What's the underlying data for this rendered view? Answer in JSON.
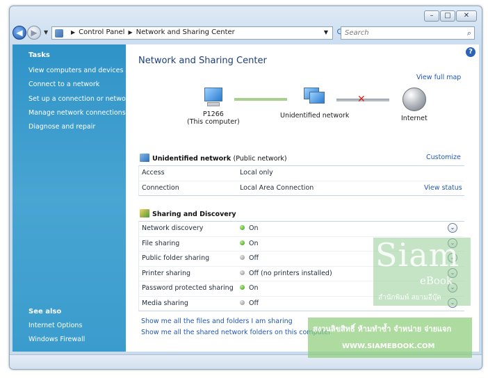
{
  "window": {
    "controls": {
      "minimize": "–",
      "maximize": "□",
      "close": "✕"
    }
  },
  "address_bar": {
    "back_icon": "back-arrow-icon",
    "forward_icon": "forward-arrow-icon",
    "crumbs": [
      "Control Panel",
      "Network and Sharing Center"
    ],
    "search_placeholder": "Search"
  },
  "sidebar": {
    "tasks_heading": "Tasks",
    "tasks": [
      "View computers and devices",
      "Connect to a network",
      "Set up a connection or network",
      "Manage network connections",
      "Diagnose and repair"
    ],
    "see_also_heading": "See also",
    "see_also": [
      "Internet Options",
      "Windows Firewall"
    ]
  },
  "main": {
    "title": "Network and Sharing Center",
    "view_full_map": "View full map",
    "map": {
      "computer_name": "P1266",
      "computer_sub": "(This computer)",
      "network_name": "Unidentified network",
      "internet_name": "Internet"
    },
    "network_section": {
      "name": "Unidentified network",
      "type": "(Public network)",
      "customize": "Customize",
      "rows": [
        {
          "label": "Access",
          "value": "Local only",
          "action": ""
        },
        {
          "label": "Connection",
          "value": "Local Area Connection",
          "action": "View status"
        }
      ]
    },
    "sharing_section": {
      "heading": "Sharing and Discovery",
      "rows": [
        {
          "label": "Network discovery",
          "value": "On",
          "state": "on"
        },
        {
          "label": "File sharing",
          "value": "On",
          "state": "on"
        },
        {
          "label": "Public folder sharing",
          "value": "Off",
          "state": "off"
        },
        {
          "label": "Printer sharing",
          "value": "Off (no printers installed)",
          "state": "off"
        },
        {
          "label": "Password protected sharing",
          "value": "On",
          "state": "on"
        },
        {
          "label": "Media sharing",
          "value": "Off",
          "state": "off"
        }
      ]
    },
    "bottom_links": [
      "Show me all the files and folders I am sharing",
      "Show me all the shared network folders on this computer"
    ]
  },
  "watermark": {
    "big": "Siam",
    "sub": "eBook",
    "thai_line1": "สำนักพิมพ์ สยามอีบุ๊ค",
    "thai_line2": "สงวนลิขสิทธิ์ ห้ามทำซ้ำ จำหน่าย จ่ายแจก",
    "url": "WWW.SIAMEBOOK.COM"
  }
}
